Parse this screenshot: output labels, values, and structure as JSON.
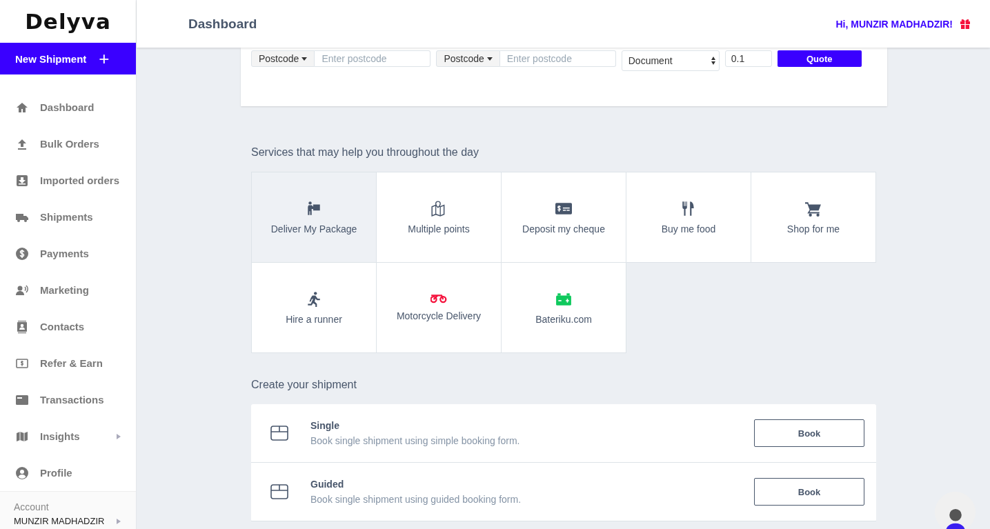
{
  "sidebar": {
    "logo": "Delyva",
    "new_button": {
      "label": "New Shipment",
      "icon": "+"
    },
    "items": [
      {
        "label": "Dashboard",
        "kind": "link"
      },
      {
        "label": "Bulk Orders",
        "kind": "link"
      },
      {
        "label": "Imported orders",
        "kind": "link"
      },
      {
        "label": "Shipments",
        "kind": "link"
      },
      {
        "label": "Payments",
        "kind": "link"
      },
      {
        "label": "Marketing",
        "kind": "link"
      },
      {
        "label": "Contacts",
        "kind": "link"
      },
      {
        "label": "Refer & Earn",
        "kind": "link"
      },
      {
        "label": "Transactions",
        "kind": "link"
      },
      {
        "label": "Insights",
        "kind": "submenu"
      },
      {
        "label": "Profile",
        "kind": "link"
      }
    ],
    "account": {
      "label": "Account",
      "name": "MUNZIR MADHADZIR"
    }
  },
  "header": {
    "title": "Dashboard",
    "greeting": "Hi, MUNZIR MADHADZIR!"
  },
  "quote_form": {
    "from": {
      "dropdown": "Postcode",
      "placeholder": "Enter postcode"
    },
    "to": {
      "dropdown": "Postcode",
      "placeholder": "Enter postcode"
    },
    "type": "Document",
    "weight": "0.1",
    "button": "Quote"
  },
  "services": {
    "title": "Services that may help you throughout the day",
    "items": [
      {
        "label": "Deliver My Package",
        "selected": true
      },
      {
        "label": "Multiple points",
        "selected": false
      },
      {
        "label": "Deposit my cheque",
        "selected": false
      },
      {
        "label": "Buy me food",
        "selected": false
      },
      {
        "label": "Shop for me",
        "selected": false
      },
      {
        "label": "Hire a runner",
        "selected": false
      },
      {
        "label": "Motorcycle Delivery",
        "selected": false
      },
      {
        "label": "Bateriku.com",
        "selected": false
      }
    ]
  },
  "shipment": {
    "title": "Create your shipment",
    "options": [
      {
        "title": "Single",
        "description": "Book single shipment using simple booking form.",
        "button": "Book"
      },
      {
        "title": "Guided",
        "description": "Book single shipment using guided booking form.",
        "button": "Book"
      }
    ]
  }
}
